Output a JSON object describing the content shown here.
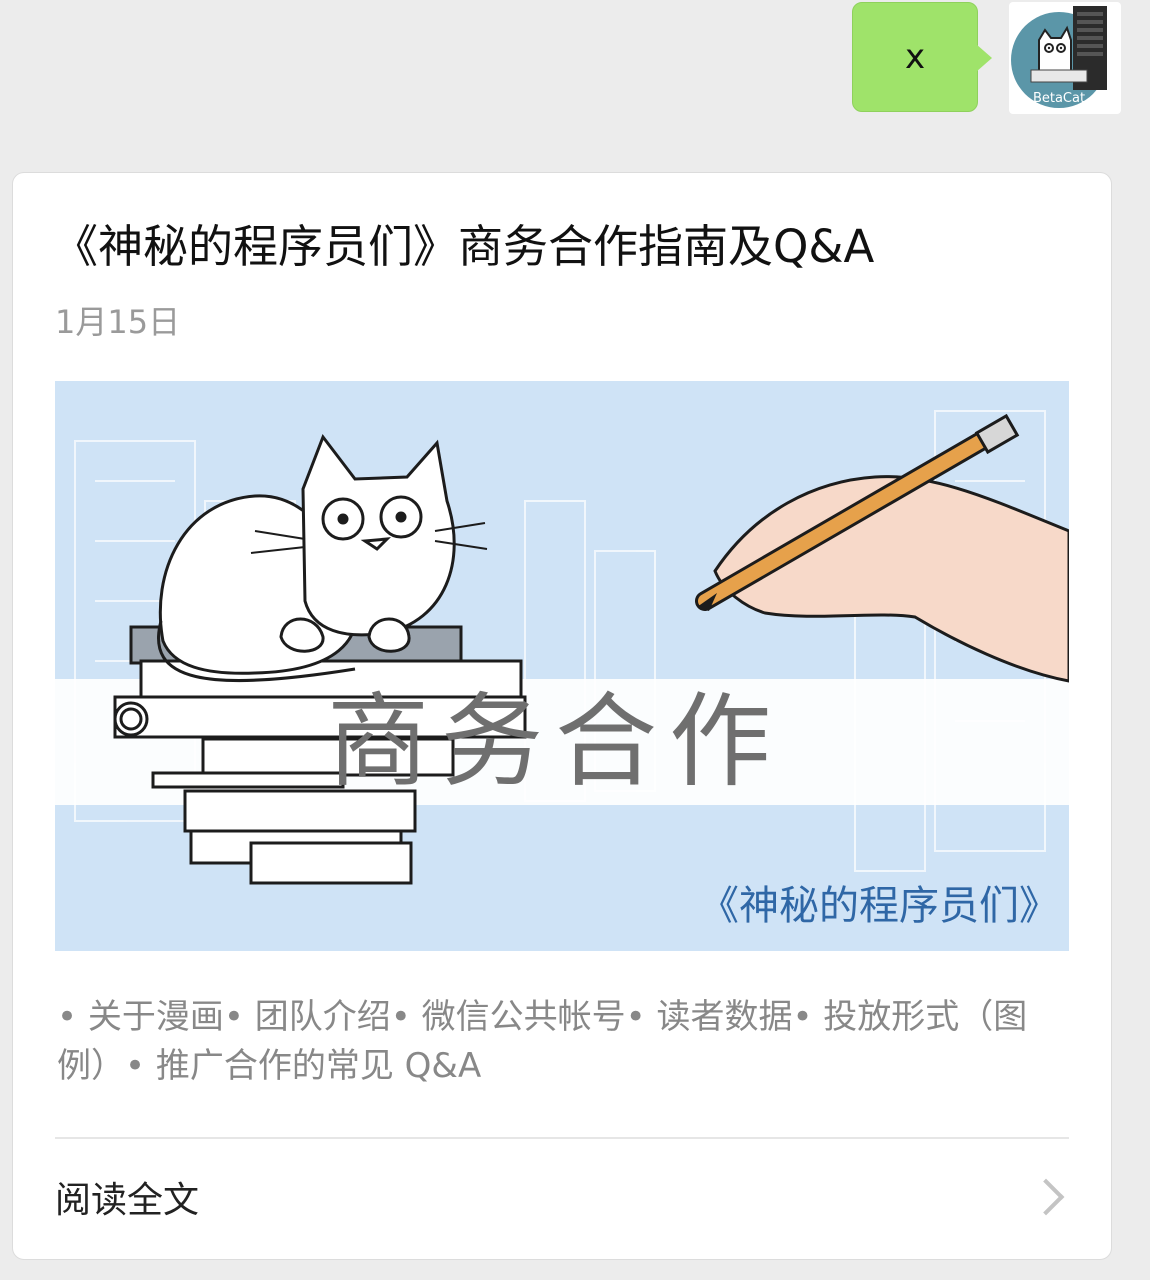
{
  "message": {
    "bubble_text": "x",
    "avatar_name": "BetaCat",
    "bubble_color": "#9fe36a"
  },
  "article": {
    "title": "《神秘的程序员们》商务合作指南及Q&A",
    "date": "1月15日",
    "cover": {
      "heading": "商务合作",
      "series": "《神秘的程序员们》"
    },
    "summary": "• 关于漫画• 团队介绍• 微信公共帐号• 读者数据• 投放形式（图例）• 推广合作的常见 Q&A",
    "read_more": "阅读全文",
    "read_more_icon": "chevron-right-icon"
  }
}
